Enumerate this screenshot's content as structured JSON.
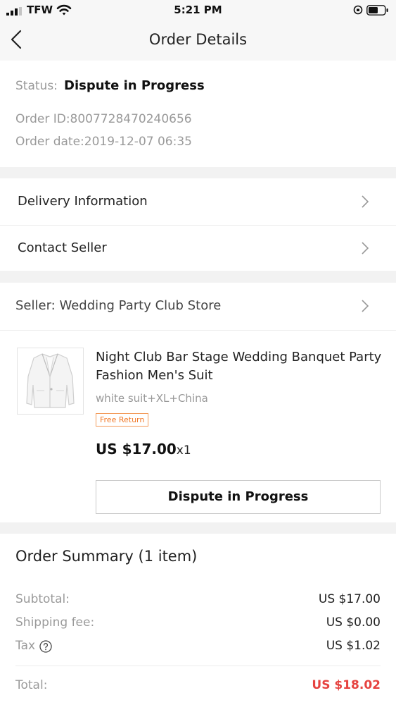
{
  "status_bar": {
    "carrier": "TFW",
    "time": "5:21 PM"
  },
  "nav": {
    "title": "Order Details"
  },
  "order": {
    "status_label": "Status:",
    "status_value": "Dispute in Progress",
    "order_id": "Order ID:8007728470240656",
    "order_date": "Order date:2019-12-07 06:35"
  },
  "links": {
    "delivery": "Delivery Information",
    "contact": "Contact Seller"
  },
  "seller": {
    "name": "Seller: Wedding Party Club Store"
  },
  "product": {
    "title": "Night Club Bar Stage Wedding Banquet Party Fashion Men's Suit",
    "variant": "white suit+XL+China",
    "badge": "Free Return",
    "price": "US $17.00",
    "quantity": "x1",
    "action_label": "Dispute in Progress"
  },
  "summary": {
    "title": "Order Summary (1 item)",
    "subtotal_label": "Subtotal:",
    "subtotal_value": "US $17.00",
    "shipping_label": "Shipping fee:",
    "shipping_value": "US $0.00",
    "tax_label": "Tax",
    "tax_value": "US $1.02",
    "total_label": "Total:",
    "total_value": "US $18.02"
  },
  "colors": {
    "accent_total": "#e64340",
    "badge_orange": "#f07a2a"
  },
  "icons": [
    "signal-icon",
    "wifi-icon",
    "orientation-lock-icon",
    "battery-icon",
    "back-arrow-icon",
    "chevron-right-icon",
    "help-circle-icon"
  ]
}
